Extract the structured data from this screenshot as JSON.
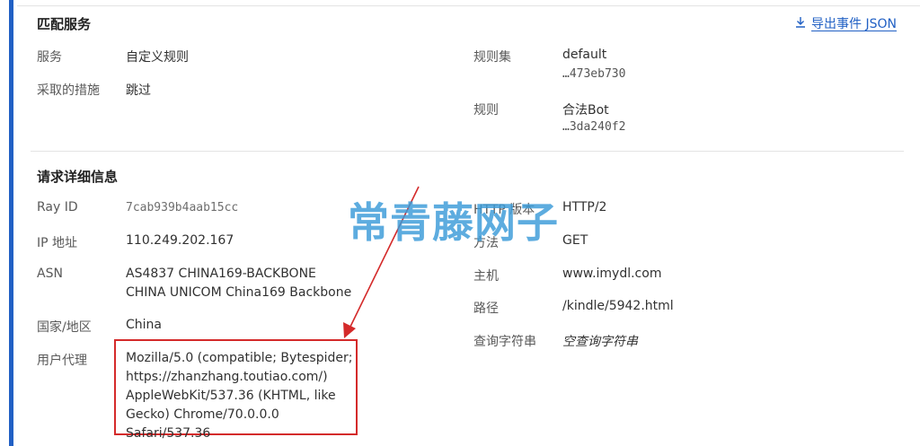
{
  "match_service": {
    "title": "匹配服务",
    "export_label": "导出事件 JSON",
    "service_label": "服务",
    "service_value": "自定义规则",
    "action_label": "采取的措施",
    "action_value": "跳过",
    "ruleset_label": "规则集",
    "ruleset_value": "default",
    "ruleset_id": "…473eb730",
    "rule_label": "规则",
    "rule_value": "合法Bot",
    "rule_id": "…3da240f2"
  },
  "request_details": {
    "title": "请求详细信息",
    "ray_id_label": "Ray ID",
    "ray_id_value": "7cab939b4aab15cc",
    "ip_label": "IP 地址",
    "ip_value": "110.249.202.167",
    "asn_label": "ASN",
    "asn_line1": "AS4837 CHINA169-BACKBONE",
    "asn_line2": "CHINA UNICOM China169 Backbone",
    "country_label": "国家/地区",
    "country_value": "China",
    "ua_label": "用户代理",
    "ua_line1": "Mozilla/5.0 (compatible; Bytespider;",
    "ua_line2": "https://zhanzhang.toutiao.com/)",
    "ua_line3": "AppleWebKit/537.36 (KHTML, like",
    "ua_line4": "Gecko) Chrome/70.0.0.0 Safari/537.36",
    "http_version_label": "HTTP 版本",
    "http_version_value": "HTTP/2",
    "method_label": "方法",
    "method_value": "GET",
    "host_label": "主机",
    "host_value": "www.imydl.com",
    "path_label": "路径",
    "path_value": "/kindle/5942.html",
    "query_label": "查询字符串",
    "query_value": "空查询字符串"
  },
  "watermark": "常青藤网子",
  "colors": {
    "accent": "#2160c4",
    "highlight_box": "#d42a2a",
    "watermark": "#3a9bd8"
  }
}
